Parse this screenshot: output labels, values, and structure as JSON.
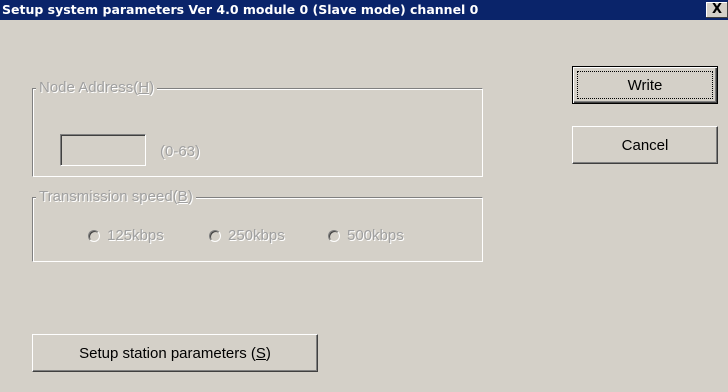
{
  "window": {
    "title": "Setup system parameters Ver 4.0 module 0 (Slave mode) channel 0",
    "close_label": "X"
  },
  "buttons": {
    "write_label": "Write",
    "cancel_label": "Cancel",
    "setup_station_prefix": "Setup station parameters (",
    "setup_station_mnemonic": "S",
    "setup_station_suffix": ")"
  },
  "node_address": {
    "legend_prefix": "Node Address(",
    "legend_mnemonic": "H",
    "legend_suffix": ")",
    "value": "",
    "range_label": "(0-63)",
    "enabled": false
  },
  "transmission_speed": {
    "legend_prefix": "Transmission speed(",
    "legend_mnemonic": "B",
    "legend_suffix": ")",
    "enabled": false,
    "options": [
      {
        "label": "125kbps",
        "selected": false
      },
      {
        "label": "250kbps",
        "selected": false
      },
      {
        "label": "500kbps",
        "selected": false
      }
    ]
  },
  "colors": {
    "titlebar": "#0a246a",
    "face": "#d4d0c8",
    "disabled_text": "#a0a0a0"
  }
}
